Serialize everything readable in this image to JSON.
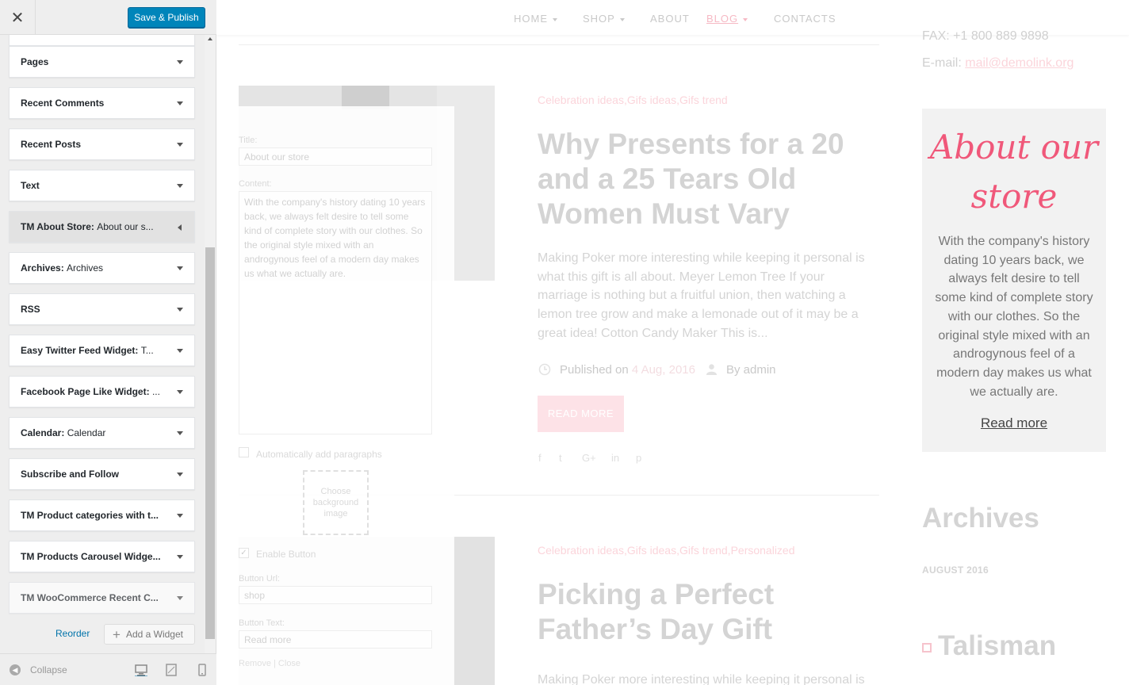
{
  "customizer": {
    "close_icon": "close-icon",
    "publish_label": "Save & Publish",
    "widgets": [
      {
        "title": "Pages",
        "sub": ""
      },
      {
        "title": "Recent Comments",
        "sub": ""
      },
      {
        "title": "Recent Posts",
        "sub": ""
      },
      {
        "title": "Text",
        "sub": ""
      },
      {
        "title": "TM About Store:",
        "sub": "About our s..."
      },
      {
        "title": "Archives:",
        "sub": "Archives"
      },
      {
        "title": "RSS",
        "sub": ""
      },
      {
        "title": "Easy Twitter Feed Widget:",
        "sub": "T..."
      },
      {
        "title": "Facebook Page Like Widget:",
        "sub": "..."
      },
      {
        "title": "Calendar:",
        "sub": "Calendar"
      },
      {
        "title": "Subscribe and Follow",
        "sub": ""
      },
      {
        "title": "TM Product categories with t...",
        "sub": ""
      },
      {
        "title": "TM Products Carousel Widge...",
        "sub": ""
      },
      {
        "title": "TM WooCommerce Recent C...",
        "sub": ""
      }
    ],
    "reorder_label": "Reorder",
    "add_widget_label": "Add a Widget",
    "collapse_label": "Collapse",
    "devices": [
      "desktop-icon",
      "tablet-icon",
      "mobile-icon"
    ]
  },
  "form": {
    "title_label": "Title:",
    "title_value": "About our store",
    "content_label": "Content:",
    "content_value": "With the company's history dating 10 years back, we always felt desire to tell some kind of complete story with our clothes. So the original style mixed with an androgynous feel of a modern day makes us what we actually are.",
    "auto_paragraphs_label": "Automatically add paragraphs",
    "bg_chooser_label": "Choose background image",
    "enable_button_label": "Enable Button",
    "button_url_label": "Button Url:",
    "button_url_value": "shop",
    "button_text_label": "Button Text:",
    "button_text_value": "Read more",
    "actions": "Remove | Close"
  },
  "nav": {
    "items": [
      "HOME",
      "SHOP",
      "ABOUT",
      "BLOG",
      "CONTACTS"
    ],
    "active": "BLOG"
  },
  "posts": [
    {
      "categories": "Celebration ideas,Gifs ideas,Gifs trend",
      "title": "Why Presents for a 20 and a 25 Tears Old Women Must Vary",
      "excerpt": "Making Poker more interesting while keeping it personal is what this gift is all about. Meyer Lemon Tree If your marriage is nothing but a fruitful union, then watching a lemon tree grow and make a lemonade out of it may be a great idea!  Cotton Candy Maker This is...",
      "published_label": "Published on",
      "date": "4 Aug, 2016",
      "author": "By admin",
      "read_more": "READ MORE",
      "social": [
        "f",
        "t",
        "G+",
        "in",
        "p"
      ]
    },
    {
      "categories": "Celebration ideas,Gifs ideas,Gifs trend,Personalized",
      "title": "Picking a Perfect Father’s Day Gift",
      "excerpt": "Making Poker more interesting while keeping it personal is"
    }
  ],
  "sidebar_right": {
    "fax": "FAX: +1 800 889 9898",
    "email_label": "E-mail:",
    "email": "mail@demolink.org",
    "about_title": "About our store",
    "about_text": "With the company's history dating 10 years back, we always felt desire to tell some kind of complete story with our clothes. So the original style mixed with an androgynous feel of a modern day makes us what we actually are.",
    "about_read_more": "Read more",
    "archives_title": "Archives",
    "archives_item": "AUGUST 2016",
    "next_widget_title": "Talisman"
  },
  "colors": {
    "accent_pink": "#f0587a",
    "publish_blue": "#0085ba"
  }
}
